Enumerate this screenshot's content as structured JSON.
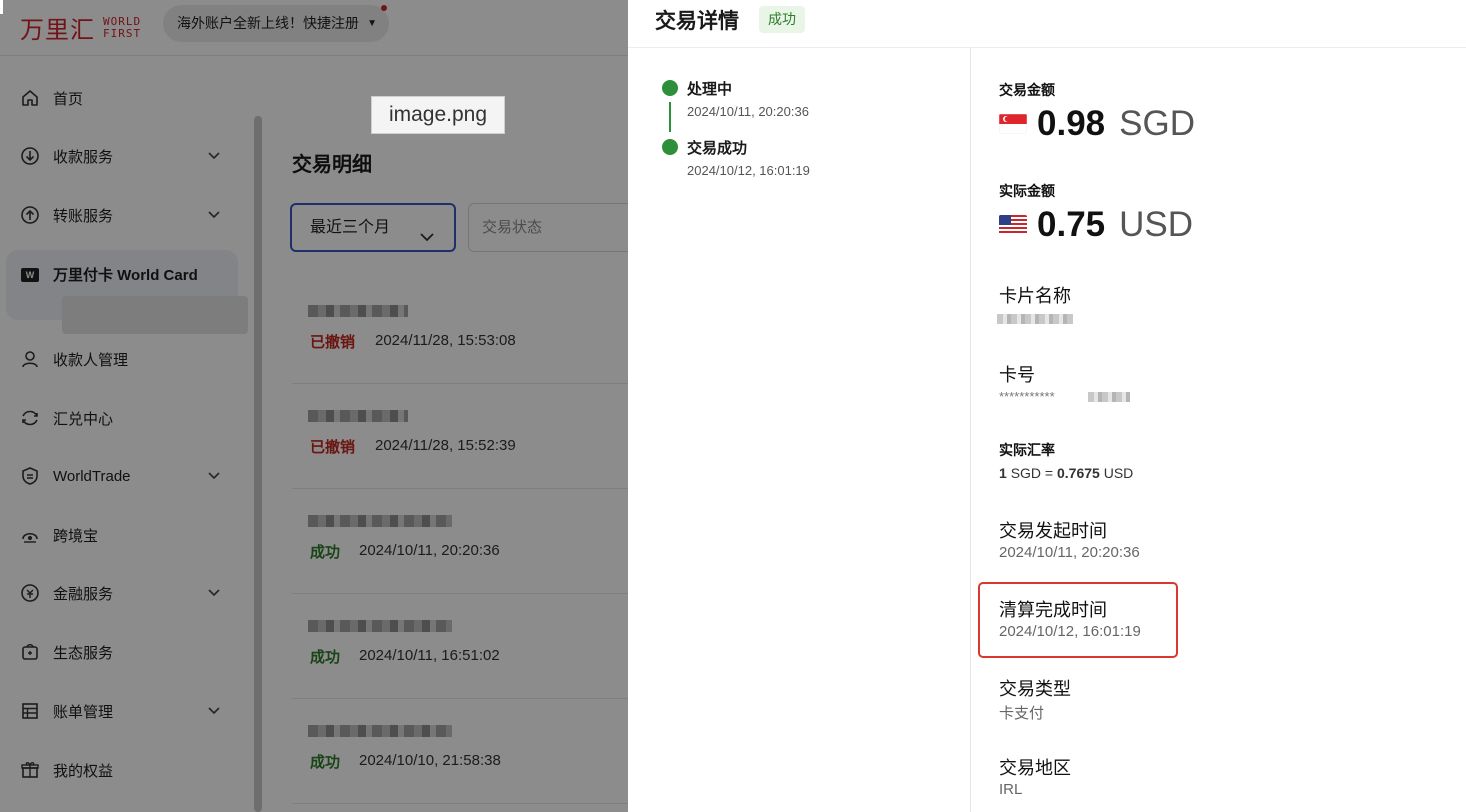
{
  "topbar": {
    "logo_cn": "万里汇",
    "logo_en_1": "WORLD",
    "logo_en_2": "FIRST",
    "promo": "海外账户全新上线！快捷注册"
  },
  "sidebar": {
    "items": [
      {
        "label": "首页",
        "icon": "home-icon"
      },
      {
        "label": "收款服务",
        "icon": "receive-icon"
      },
      {
        "label": "转账服务",
        "icon": "transfer-icon"
      },
      {
        "label": "万里付卡 World Card",
        "icon": "world-card-icon",
        "badge": "W"
      },
      {
        "label": "收款人管理",
        "icon": "payee-icon"
      },
      {
        "label": "汇兑中心",
        "icon": "exchange-icon"
      },
      {
        "label": "WorldTrade",
        "icon": "worldtrade-icon"
      },
      {
        "label": "跨境宝",
        "icon": "crossborder-icon"
      },
      {
        "label": "金融服务",
        "icon": "finance-icon"
      },
      {
        "label": "生态服务",
        "icon": "ecosystem-icon"
      },
      {
        "label": "账单管理",
        "icon": "bill-icon"
      },
      {
        "label": "我的权益",
        "icon": "gift-icon"
      }
    ]
  },
  "main": {
    "title": "交易明细",
    "filter_range": "最近三个月",
    "filter_status_placeholder": "交易状态",
    "rows": [
      {
        "status": "已撤销",
        "status_type": "cancel",
        "time": "2024/11/28, 15:53:08"
      },
      {
        "status": "已撤销",
        "status_type": "cancel",
        "time": "2024/11/28, 15:52:39"
      },
      {
        "status": "成功",
        "status_type": "ok",
        "time": "2024/10/11, 20:20:36"
      },
      {
        "status": "成功",
        "status_type": "ok",
        "time": "2024/10/11, 16:51:02"
      },
      {
        "status": "成功",
        "status_type": "ok",
        "time": "2024/10/10, 21:58:38"
      }
    ]
  },
  "tooltip": "image.png",
  "drawer": {
    "title": "交易详情",
    "status_badge": "成功",
    "timeline": [
      {
        "label": "处理中",
        "time": "2024/10/11, 20:20:36"
      },
      {
        "label": "交易成功",
        "time": "2024/10/12, 16:01:19"
      }
    ],
    "amount_label": "交易金额",
    "amount_value": "0.98",
    "amount_currency": "SGD",
    "actual_label": "实际金额",
    "actual_value": "0.75",
    "actual_currency": "USD",
    "card_name_label": "卡片名称",
    "card_no_label": "卡号",
    "card_no_prefix": "***********",
    "rate_label": "实际汇率",
    "rate_left": "1",
    "rate_from": "SGD =",
    "rate_value": "0.7675",
    "rate_to": "USD",
    "start_time_label": "交易发起时间",
    "start_time": "2024/10/11, 20:20:36",
    "clear_time_label": "清算完成时间",
    "clear_time": "2024/10/12, 16:01:19",
    "type_label": "交易类型",
    "type_value": "卡支付",
    "region_label": "交易地区",
    "region_value": "IRL"
  },
  "colors": {
    "brand_red": "#d2232a",
    "success_green": "#2f7d2b",
    "cancel_red": "#c4271f",
    "highlight": "#d9382f",
    "accent_blue": "#3a56c5"
  }
}
